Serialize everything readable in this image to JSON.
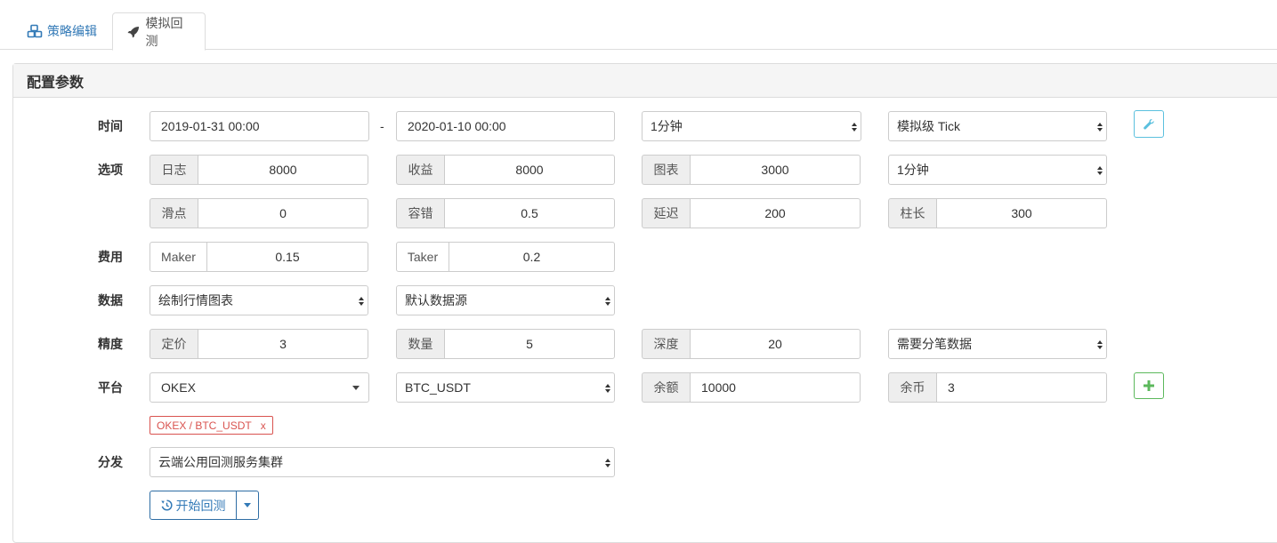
{
  "tabs": [
    {
      "label": "策略编辑",
      "icon": "cubes-icon"
    },
    {
      "label": "模拟回测",
      "icon": "rocket-icon"
    }
  ],
  "panel": {
    "title": "配置参数"
  },
  "labels": {
    "time": "时间",
    "options": "选项",
    "fee": "费用",
    "data": "数据",
    "precision": "精度",
    "platform": "平台",
    "dispatch": "分发"
  },
  "time": {
    "start": "2019-01-31 00:00",
    "sep": "-",
    "end": "2020-01-10 00:00",
    "period": "1分钟",
    "mode": "模拟级 Tick"
  },
  "options": {
    "log_label": "日志",
    "log_value": "8000",
    "profit_label": "收益",
    "profit_value": "8000",
    "chart_label": "图表",
    "chart_value": "3000",
    "period2": "1分钟",
    "slippage_label": "滑点",
    "slippage_value": "0",
    "tolerance_label": "容错",
    "tolerance_value": "0.5",
    "delay_label": "延迟",
    "delay_value": "200",
    "bar_label": "柱长",
    "bar_value": "300"
  },
  "fee": {
    "maker_label": "Maker",
    "maker_value": "0.15",
    "taker_label": "Taker",
    "taker_value": "0.2"
  },
  "data": {
    "chart_select": "绘制行情图表",
    "source_select": "默认数据源"
  },
  "precision": {
    "price_label": "定价",
    "price_value": "3",
    "amount_label": "数量",
    "amount_value": "5",
    "depth_label": "深度",
    "depth_value": "20",
    "trades_select": "需要分笔数据"
  },
  "platform": {
    "exchange": "OKEX",
    "pair": "BTC_USDT",
    "balance_label": "余额",
    "balance_value": "10000",
    "stocks_label": "余币",
    "stocks_value": "3",
    "tag": "OKEX / BTC_USDT",
    "tag_remove": "x"
  },
  "dispatch": {
    "cluster": "云端公用回测服务集群"
  },
  "start": {
    "label": "开始回测"
  },
  "colors": {
    "primary": "#337ab7",
    "info": "#5bc0de",
    "success": "#5cb85c",
    "danger": "#d9534f"
  }
}
